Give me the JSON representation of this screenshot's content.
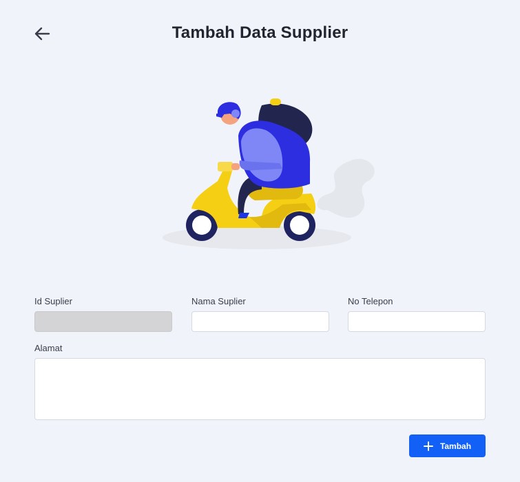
{
  "header": {
    "title": "Tambah Data Supplier",
    "back_icon": "arrow-left-icon"
  },
  "illustration": {
    "subject": "scooter-delivery-illustration",
    "colors": {
      "scooter": "#f5cf14",
      "rider": "#3535d9",
      "bag": "#22264f",
      "smoke": "#e6e9ee"
    }
  },
  "form": {
    "id_label": "Id Suplier",
    "id_value": "",
    "nama_label": "Nama Suplier",
    "nama_value": "",
    "telepon_label": "No Telepon",
    "telepon_value": "",
    "alamat_label": "Alamat",
    "alamat_value": ""
  },
  "actions": {
    "submit_label": "Tambah",
    "submit_icon": "plus-icon"
  },
  "colors": {
    "background": "#f0f3f9",
    "primary": "#1260f5",
    "disabled_field": "#d4d4d6"
  }
}
